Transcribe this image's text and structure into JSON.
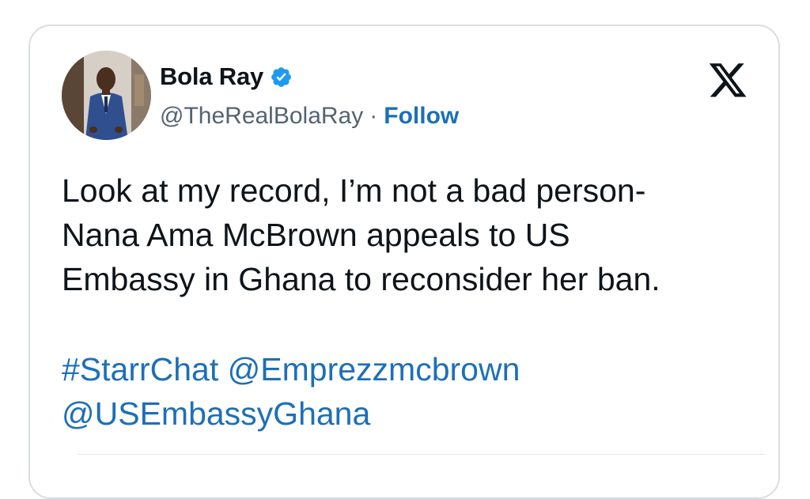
{
  "author": {
    "name": "Bola Ray",
    "handle": "@TheRealBolaRay",
    "separator": "·",
    "follow_label": "Follow",
    "verified": true,
    "verified_color": "#1d9bf0"
  },
  "platform_icon": "x-logo-icon",
  "tweet": {
    "lines": [
      "Look at my record, I’m not a bad person-",
      "Nana Ama McBrown appeals to US",
      "Embassy in Ghana to reconsider her ban."
    ],
    "tags": {
      "hashtag": "#StarrChat",
      "mention1": "@Emprezzmcbrown",
      "mention2": "@USEmbassyGhana"
    }
  },
  "colors": {
    "text": "#0f1419",
    "secondary": "#536471",
    "link": "#1d6fb8",
    "border": "#d9dee3"
  }
}
